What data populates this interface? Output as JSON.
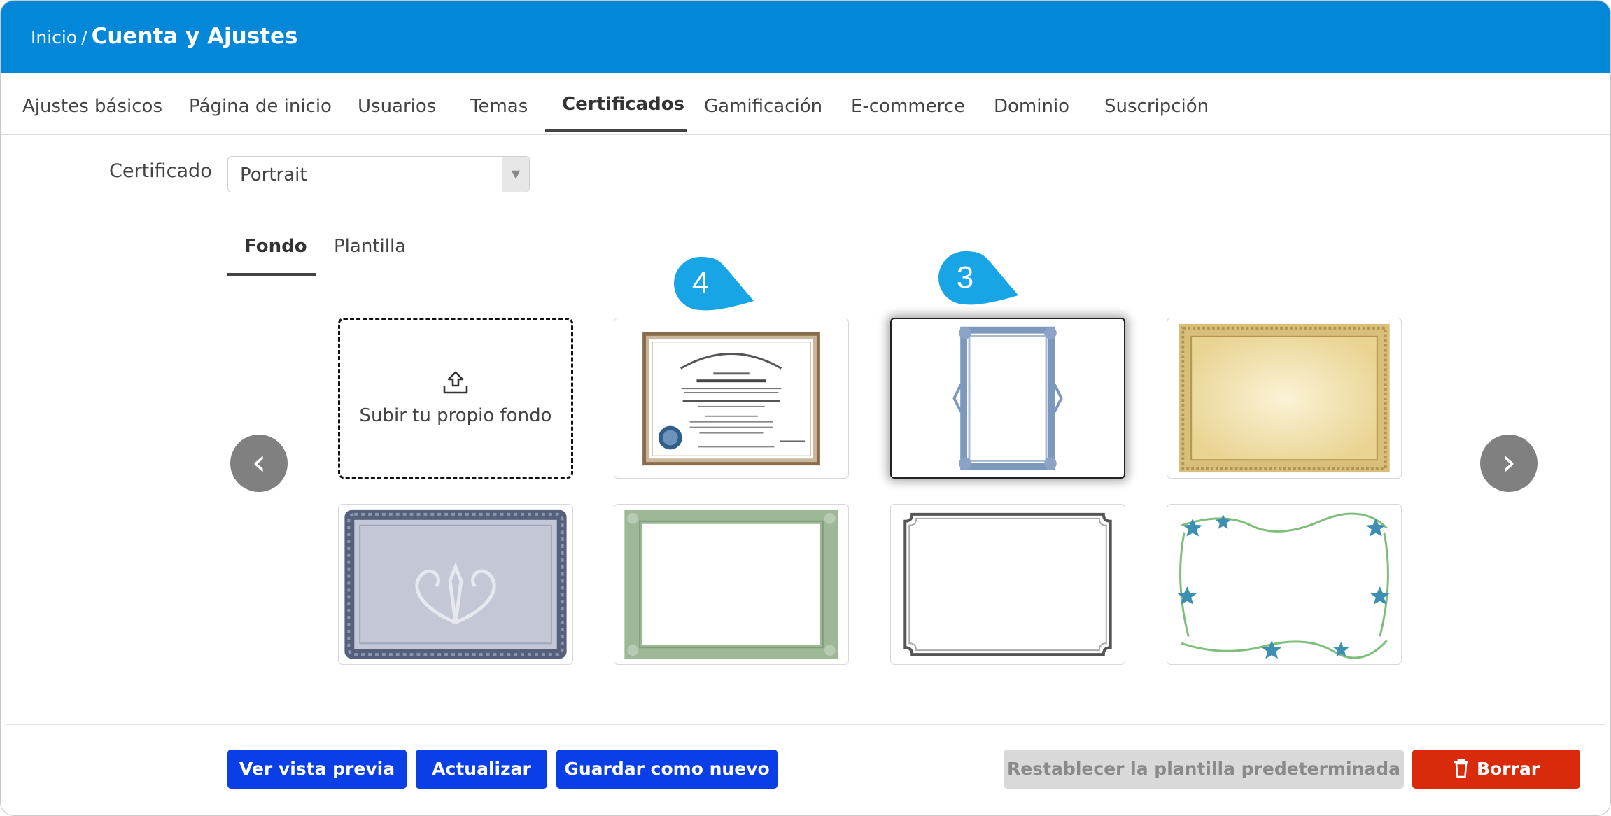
{
  "breadcrumb": {
    "home": "Inicio",
    "separator": "/",
    "current": "Cuenta y Ajustes"
  },
  "nav": {
    "items": [
      {
        "label": "Ajustes básicos"
      },
      {
        "label": "Página de inicio"
      },
      {
        "label": "Usuarios"
      },
      {
        "label": "Temas"
      },
      {
        "label": "Certificados",
        "active": true
      },
      {
        "label": "Gamificación"
      },
      {
        "label": "E-commerce"
      },
      {
        "label": "Dominio"
      },
      {
        "label": "Suscripción"
      }
    ]
  },
  "certificate": {
    "label": "Certificado",
    "selected": "Portrait"
  },
  "subtabs": [
    {
      "label": "Fondo",
      "active": true
    },
    {
      "label": "Plantilla"
    }
  ],
  "gallery": {
    "upload_label": "Subir tu propio fondo",
    "callouts": [
      "4",
      "3"
    ],
    "selected_index": 2
  },
  "actions": {
    "preview": "Ver vista previa",
    "update": "Actualizar",
    "save_new": "Guardar como nuevo",
    "reset": "Restablecer la plantilla predeterminada",
    "delete": "Borrar"
  },
  "colors": {
    "header": "#0287d9",
    "primary": "#0a3ee6",
    "danger": "#d92b0b",
    "callout": "#17a5e6"
  }
}
